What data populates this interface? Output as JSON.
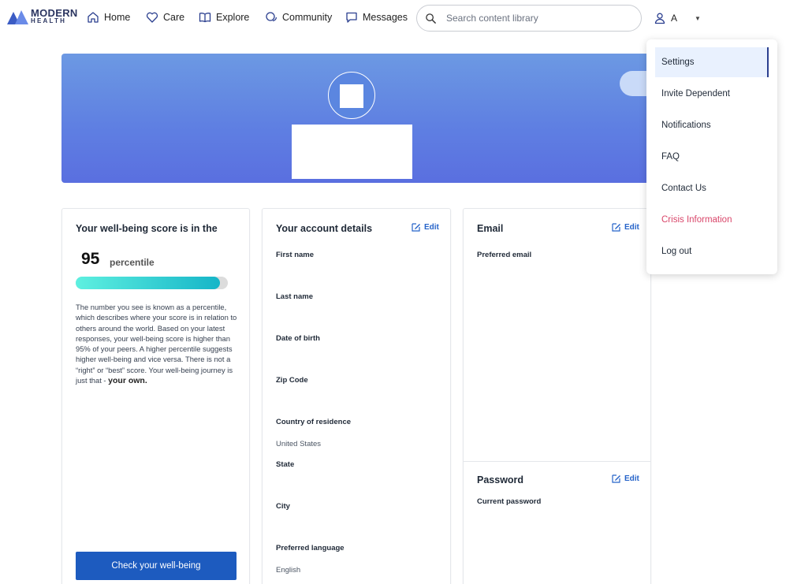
{
  "nav": {
    "logo_line1": "MODERN",
    "logo_line2": "HEALTH",
    "items": [
      {
        "label": "Home",
        "icon": "home-icon"
      },
      {
        "label": "Care",
        "icon": "heart-icon"
      },
      {
        "label": "Explore",
        "icon": "book-icon"
      },
      {
        "label": "Community",
        "icon": "community-icon"
      },
      {
        "label": "Messages",
        "icon": "message-icon"
      }
    ],
    "search_placeholder": "Search content library",
    "user_initial": "A"
  },
  "score_card": {
    "title": "Your well-being score is in the",
    "score": "95",
    "unit": "percentile",
    "progress_percent": 95,
    "description": "The number you see is known as a percentile, which describes where your score is in relation to others around the world. Based on your latest responses, your well-being score is higher than 95% of your peers. A higher percentile suggests higher well-being and vice versa. There is not a “right” or “best” score. Your well-being journey is just that - ",
    "description_bold": "your own.",
    "button": "Check your well-being"
  },
  "account": {
    "title": "Your account details",
    "edit": "Edit",
    "fields": {
      "first_name": "First name",
      "last_name": "Last name",
      "dob": "Date of birth",
      "zip": "Zip Code",
      "country": "Country of residence",
      "country_value": "United States",
      "state": "State",
      "city": "City",
      "language": "Preferred language",
      "language_value": "English"
    }
  },
  "email": {
    "title": "Email",
    "edit": "Edit",
    "preferred_label": "Preferred email"
  },
  "password": {
    "title": "Password",
    "edit": "Edit",
    "current_label": "Current password"
  },
  "menu": {
    "items": [
      "Settings",
      "Invite Dependent",
      "Notifications",
      "FAQ",
      "Contact Us",
      "Crisis Information",
      "Log out"
    ],
    "crisis_color": "#d9466a"
  },
  "colors": {
    "brand": "#1d5bbf",
    "link": "#2563c9"
  }
}
